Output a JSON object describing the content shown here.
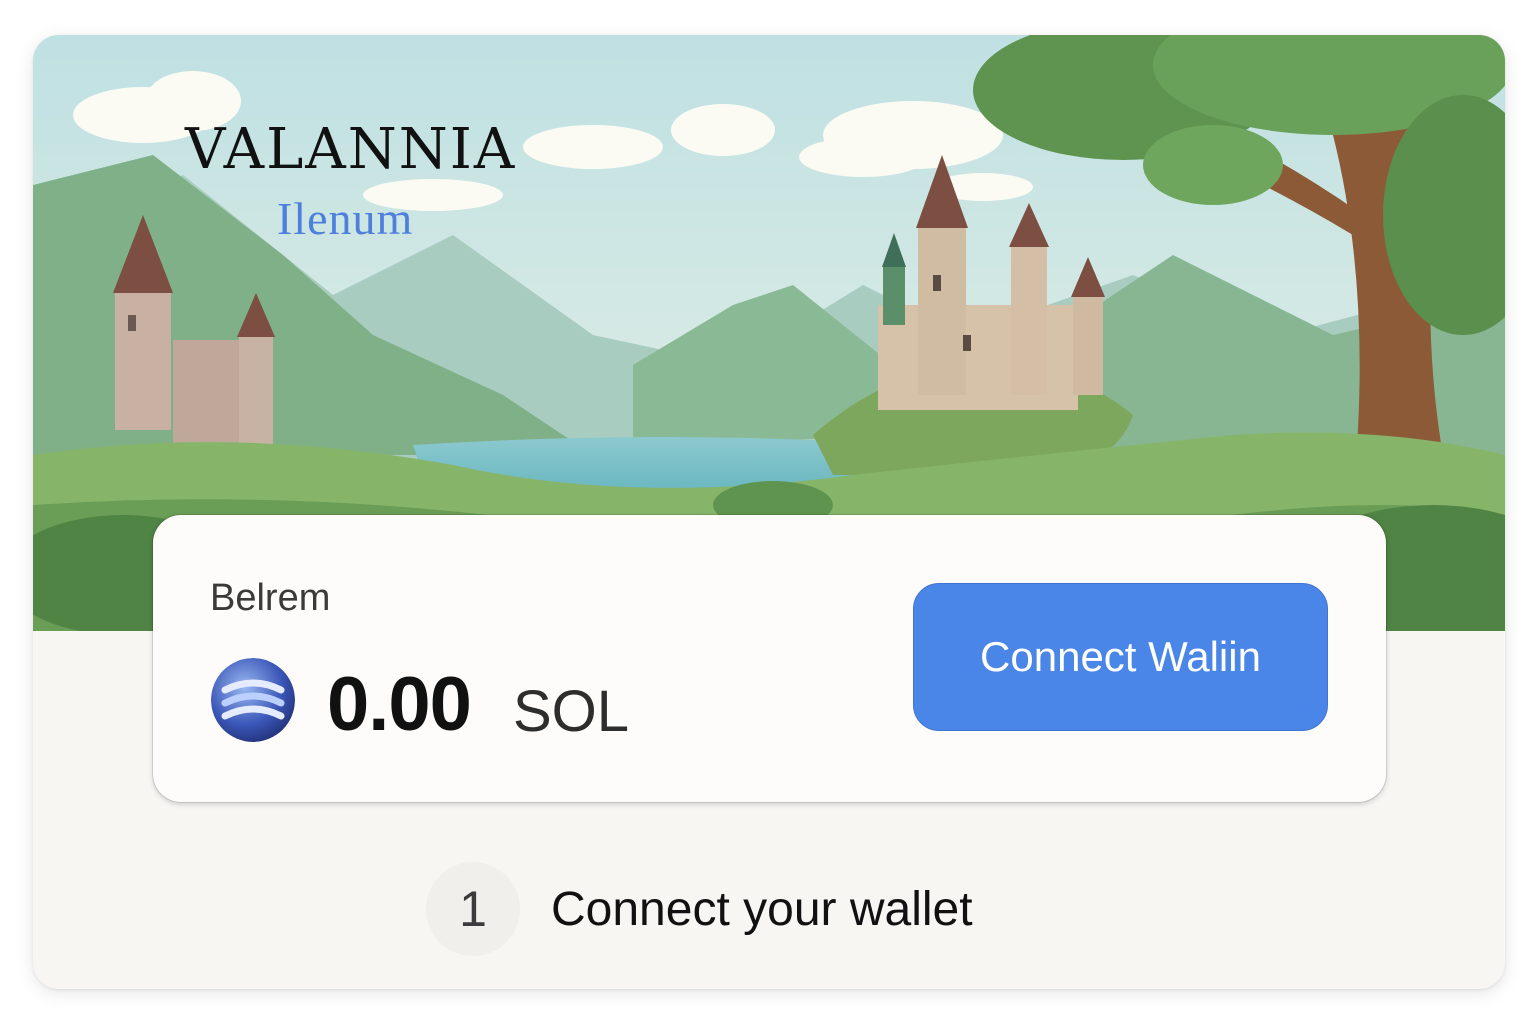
{
  "hero": {
    "logo_title": "VALANNIA",
    "logo_subtitle": "Ilenum"
  },
  "balance": {
    "label": "Belrem",
    "amount": "0.00",
    "unit": "SOL",
    "token_icon": "sol-token-icon"
  },
  "actions": {
    "connect_label": "Connect Waliin"
  },
  "steps": [
    {
      "number": "1",
      "text": "Connect your wallet"
    }
  ],
  "colors": {
    "accent": "#4a86e8",
    "logo_subtitle": "#4f7fdd",
    "card_background": "#f8f6f3"
  }
}
